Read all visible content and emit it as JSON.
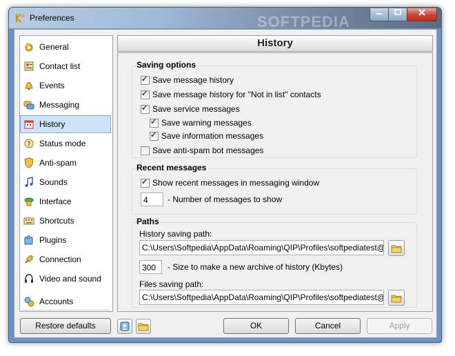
{
  "window": {
    "title": "Preferences",
    "watermark": "SOFTPEDIA"
  },
  "sidebar": {
    "items": [
      {
        "label": "General",
        "icon": "gear-person-icon"
      },
      {
        "label": "Contact list",
        "icon": "contact-list-icon"
      },
      {
        "label": "Events",
        "icon": "bell-icon"
      },
      {
        "label": "Messaging",
        "icon": "messaging-icon"
      },
      {
        "label": "History",
        "icon": "calendar-icon"
      },
      {
        "label": "Status mode",
        "icon": "status-icon"
      },
      {
        "label": "Anti-spam",
        "icon": "shield-icon"
      },
      {
        "label": "Sounds",
        "icon": "music-note-icon"
      },
      {
        "label": "Interface",
        "icon": "interface-icon"
      },
      {
        "label": "Shortcuts",
        "icon": "keyboard-icon"
      },
      {
        "label": "Plugins",
        "icon": "puzzle-icon"
      },
      {
        "label": "Connection",
        "icon": "plug-icon"
      },
      {
        "label": "Video and sound",
        "icon": "headset-icon"
      },
      {
        "label": "Accounts",
        "icon": "accounts-icon"
      }
    ],
    "selected": "History"
  },
  "panel": {
    "title": "History",
    "saving_options": {
      "title": "Saving options",
      "items": [
        {
          "label": "Save message history",
          "checked": true
        },
        {
          "label": "Save message history for \"Not in list\" contacts",
          "checked": true
        },
        {
          "label": "Save service messages",
          "checked": true
        },
        {
          "label": "Save warning messages",
          "checked": true
        },
        {
          "label": "Save information messages",
          "checked": true
        },
        {
          "label": "Save anti-spam bot messages",
          "checked": false
        }
      ]
    },
    "recent_messages": {
      "title": "Recent messages",
      "show_label": "Show recent messages in messaging window",
      "show_checked": true,
      "count_value": "4",
      "count_label": "- Number of messages to show"
    },
    "paths": {
      "title": "Paths",
      "history_label": "History saving path:",
      "history_path": "C:\\Users\\Softpedia\\AppData\\Roaming\\QIP\\Profiles\\softpediatest@qip.ru",
      "size_value": "300",
      "size_label": "- Size to make a new archive of history (Kbytes)",
      "files_label": "Files saving path:",
      "files_path": "C:\\Users\\Softpedia\\AppData\\Roaming\\QIP\\Profiles\\softpediatest@qip.ru"
    }
  },
  "footer": {
    "restore_label": "Restore defaults",
    "ok_label": "OK",
    "cancel_label": "Cancel",
    "apply_label": "Apply"
  }
}
